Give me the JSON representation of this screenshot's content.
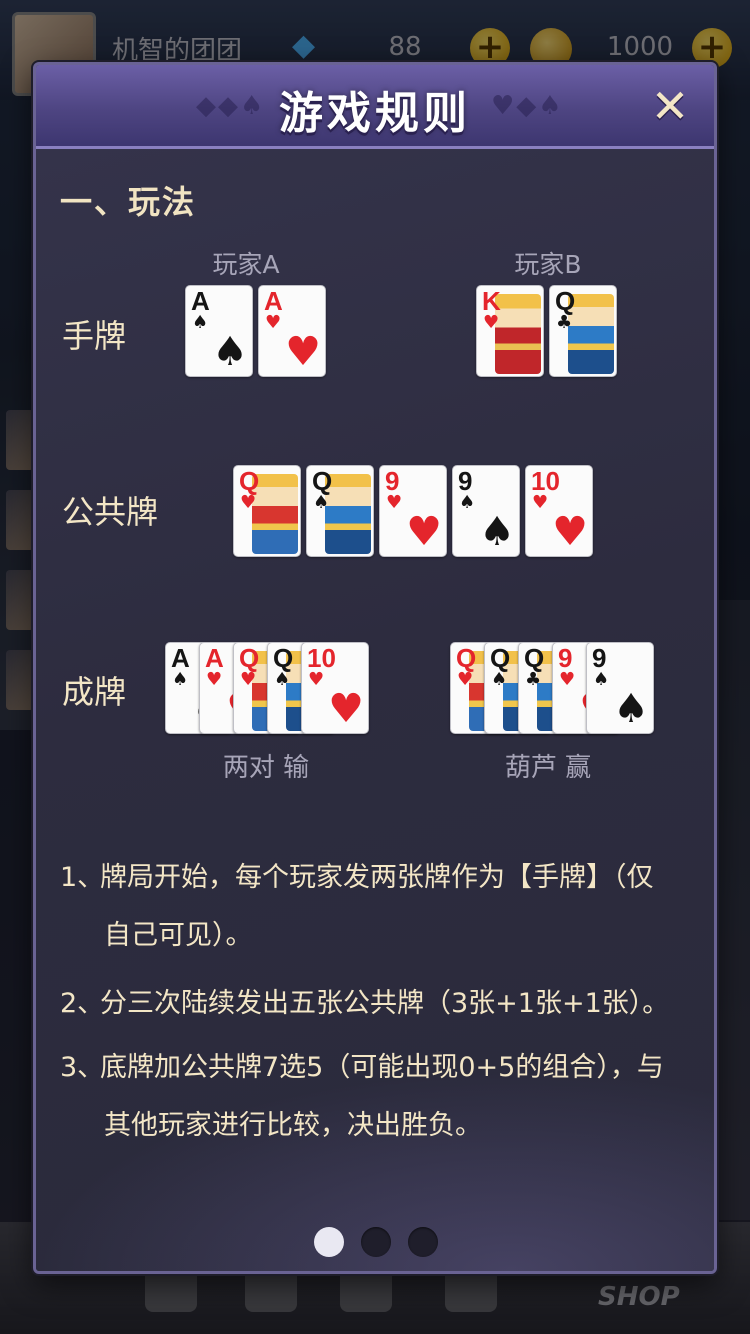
{
  "background": {
    "username": "机智的团团",
    "gems": "88",
    "coins": "1000",
    "shop_label": "SHOP"
  },
  "dialog": {
    "title": "游戏规则",
    "close_symbol": "✕",
    "section_title": "一、玩法",
    "player_a": "玩家A",
    "player_b": "玩家B",
    "labels": {
      "hand": "手牌",
      "community": "公共牌",
      "made_hand": "成牌"
    },
    "hand_a": [
      {
        "rank": "A",
        "suit": "♠",
        "color": "black"
      },
      {
        "rank": "A",
        "suit": "♥",
        "color": "red"
      }
    ],
    "hand_b": [
      {
        "rank": "K",
        "suit": "♥",
        "color": "red"
      },
      {
        "rank": "Q",
        "suit": "♣",
        "color": "black"
      }
    ],
    "community": [
      {
        "rank": "Q",
        "suit": "♥",
        "color": "red"
      },
      {
        "rank": "Q",
        "suit": "♠",
        "color": "black"
      },
      {
        "rank": "9",
        "suit": "♥",
        "color": "red"
      },
      {
        "rank": "9",
        "suit": "♠",
        "color": "black"
      },
      {
        "rank": "10",
        "suit": "♥",
        "color": "red"
      }
    ],
    "made_a": [
      {
        "rank": "A",
        "suit": "♠",
        "color": "black"
      },
      {
        "rank": "A",
        "suit": "♥",
        "color": "red"
      },
      {
        "rank": "Q",
        "suit": "♥",
        "color": "red"
      },
      {
        "rank": "Q",
        "suit": "♠",
        "color": "black"
      },
      {
        "rank": "10",
        "suit": "♥",
        "color": "red"
      }
    ],
    "made_b": [
      {
        "rank": "Q",
        "suit": "♥",
        "color": "red"
      },
      {
        "rank": "Q",
        "suit": "♠",
        "color": "black"
      },
      {
        "rank": "Q",
        "suit": "♣",
        "color": "black"
      },
      {
        "rank": "9",
        "suit": "♥",
        "color": "red"
      },
      {
        "rank": "9",
        "suit": "♠",
        "color": "black"
      }
    ],
    "result_a": "两对  输",
    "result_b": "葫芦  赢",
    "rules": [
      {
        "num": "1、",
        "line1": "牌局开始，每个玩家发两张牌作为【手牌】（仅",
        "line2": "自己可见）。"
      },
      {
        "num": "2、",
        "line1": "分三次陆续发出五张公共牌（3张+1张+1张）。",
        "line2": ""
      },
      {
        "num": "3、",
        "line1": "底牌加公共牌7选5（可能出现0+5的组合），与",
        "line2": "其他玩家进行比较，决出胜负。"
      }
    ],
    "pages": {
      "current": 1,
      "total": 3
    }
  }
}
